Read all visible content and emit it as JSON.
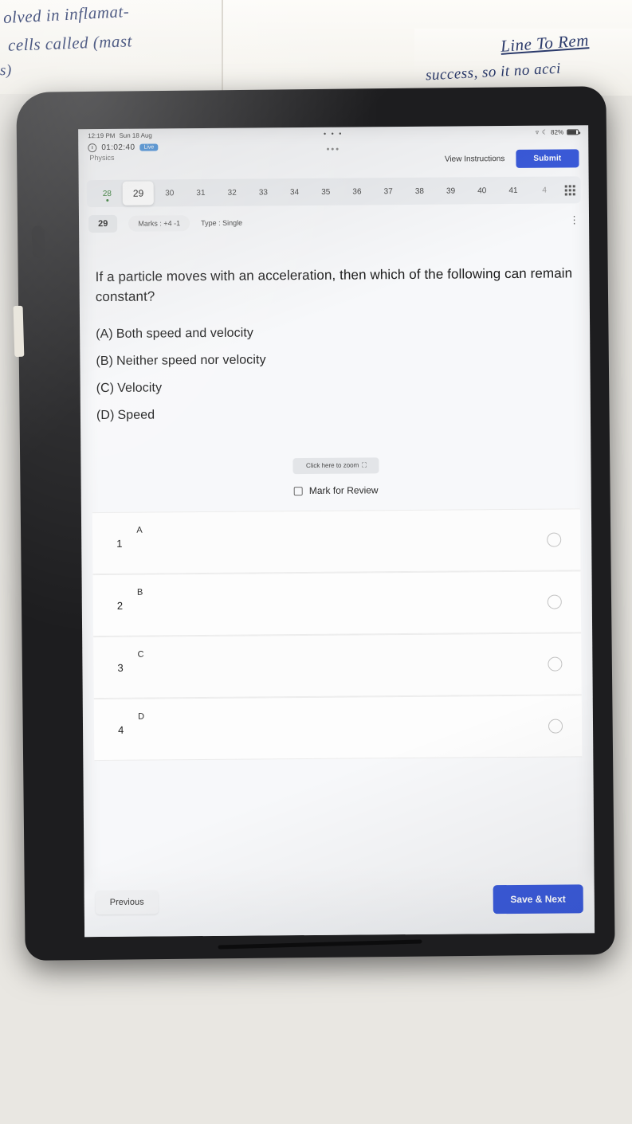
{
  "photo": {
    "handwriting": [
      "olved in inflamat-",
      "cells called (mast",
      "s)",
      "Line To Rem",
      "success, so it no acci"
    ]
  },
  "status_bar": {
    "time": "12:19 PM",
    "date": "Sun 18 Aug",
    "center_dots": "• • •",
    "wifi_icon": "wifi-icon",
    "battery_text": "82%"
  },
  "test_header": {
    "timer": "01:02:40",
    "live_label": "Live",
    "subject": "Physics",
    "view_instructions": "View Instructions",
    "submit_label": "Submit"
  },
  "question_strip": {
    "numbers": [
      "28",
      "29",
      "30",
      "31",
      "32",
      "33",
      "34",
      "35",
      "36",
      "37",
      "38",
      "39",
      "40",
      "41",
      "4"
    ],
    "current": "29",
    "answered": [
      "28"
    ],
    "grid_icon": "grid-icon"
  },
  "meta": {
    "question_number": "29",
    "marks": "Marks : +4 -1",
    "type": "Type : Single",
    "kebab_icon": "more-vertical-icon"
  },
  "question": {
    "text": "If a particle moves with an acceleration, then which of the following can remain constant?",
    "options": [
      {
        "label": "(A)",
        "text": "Both speed and velocity"
      },
      {
        "label": "(B)",
        "text": "Neither speed nor velocity"
      },
      {
        "label": "(C)",
        "text": "Velocity"
      },
      {
        "label": "(D)",
        "text": "Speed"
      }
    ],
    "zoom_chip": "Click here to zoom",
    "zoom_icon": "expand-icon",
    "mark_for_review": "Mark for Review"
  },
  "answers": [
    {
      "index": "1",
      "letter": "A"
    },
    {
      "index": "2",
      "letter": "B"
    },
    {
      "index": "3",
      "letter": "C"
    },
    {
      "index": "4",
      "letter": "D"
    }
  ],
  "footer": {
    "previous": "Previous",
    "save_next": "Save & Next"
  },
  "colors": {
    "accent": "#3b5bdb",
    "answered": "#2f7a2f",
    "tablet": "#1d1d1f"
  }
}
